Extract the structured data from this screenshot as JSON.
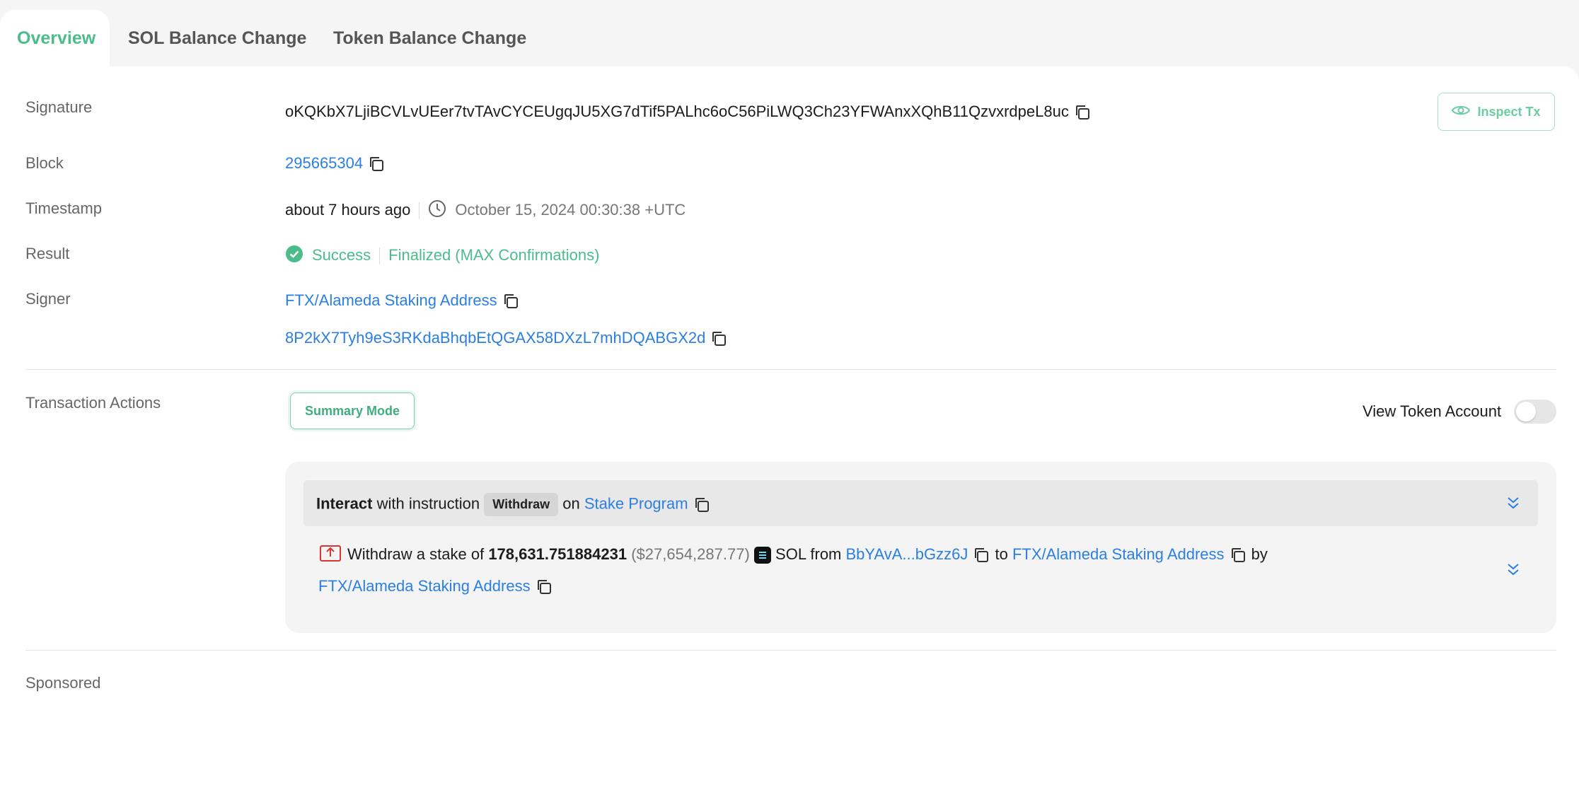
{
  "tabs": [
    {
      "label": "Overview"
    },
    {
      "label": "SOL Balance Change"
    },
    {
      "label": "Token Balance Change"
    }
  ],
  "fields": {
    "signature_label": "Signature",
    "signature": "oKQKbX7LjiBCVLvUEer7tvTAvCYCEUgqJU5XG7dTif5PALhc6oC56PiLWQ3Ch23YFWAnxXQhB11QzvxrdpeL8uc",
    "inspect_label": "Inspect Tx",
    "block_label": "Block",
    "block": "295665304",
    "timestamp_label": "Timestamp",
    "timestamp_relative": "about 7 hours ago",
    "timestamp_absolute": "October 15, 2024 00:30:38 +UTC",
    "result_label": "Result",
    "result_status": "Success",
    "result_confirmation": "Finalized (MAX Confirmations)",
    "signer_label": "Signer",
    "signer_name": "FTX/Alameda Staking Address",
    "signer_address": "8P2kX7Tyh9eS3RKdaBhqbEtQGAX58DXzL7mhDQABGX2d"
  },
  "actions": {
    "label": "Transaction Actions",
    "summary_mode": "Summary Mode",
    "view_token_account": "View Token Account",
    "instruction": {
      "interact": "Interact",
      "with_instruction": "with instruction",
      "badge": "Withdraw",
      "on": "on",
      "program": "Stake Program"
    },
    "detail": {
      "prefix": "Withdraw a stake of",
      "amount": "178,631.751884231",
      "usd": "($27,654,287.77)",
      "token": "SOL",
      "from": "from",
      "from_account": "BbYAvA...bGzz6J",
      "to": "to",
      "to_account": "FTX/Alameda Staking Address",
      "by": "by",
      "by_account": "FTX/Alameda Staking Address"
    }
  },
  "sponsored": "Sponsored",
  "colors": {
    "accent": "#4cbc8c",
    "link": "#2b7fe0"
  }
}
